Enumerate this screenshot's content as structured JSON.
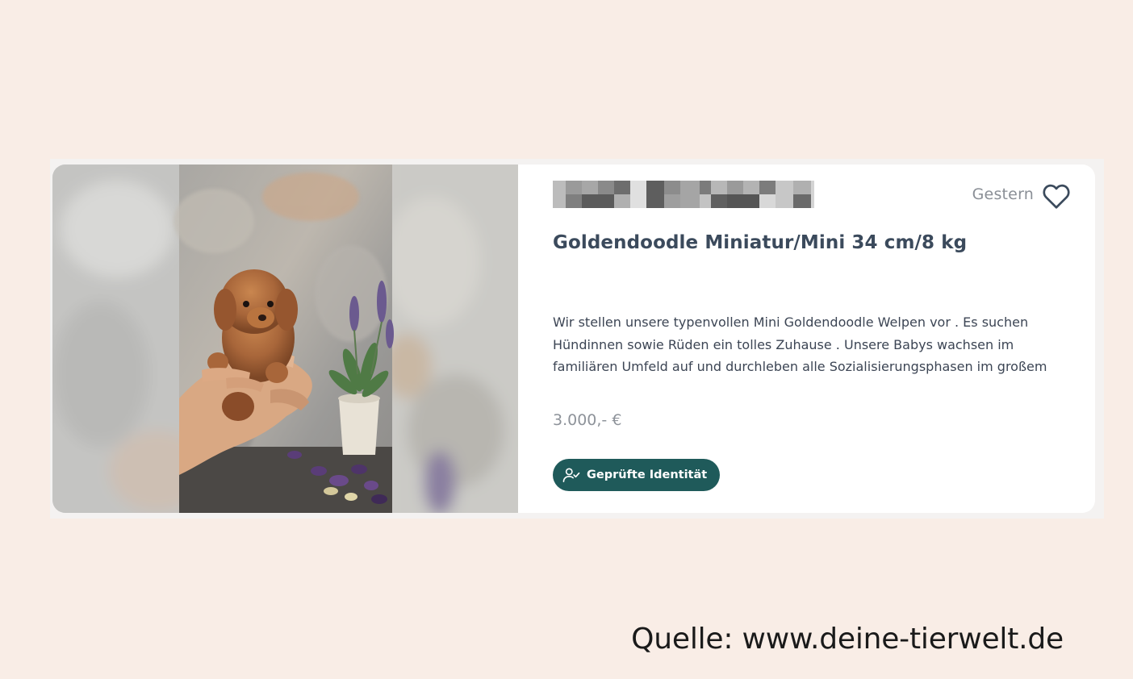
{
  "listing": {
    "date": "Gestern",
    "title": "Goldendoodle Miniatur/Mini 34 cm/8 kg",
    "description": "Wir stellen unsere typenvollen Mini Goldendoodle Welpen vor . Es suchen Hündinnen sowie Rüden ein tolles Zuhause . Unsere Babys wachsen im familiären Umfeld auf und durchleben alle Sozialisierungsphasen im großem",
    "price": "3.000,- €",
    "badge_label": "Geprüfte Identität",
    "icons": {
      "favorite": "heart-icon",
      "badge": "user-check-icon"
    }
  },
  "source_caption": "Quelle: www.deine-tierwelt.de",
  "colors": {
    "page_background": "#f9ede6",
    "card_background": "#ffffff",
    "title": "#3b4a5c",
    "badge_background": "#1f5a5a",
    "muted_text": "#8a8f96"
  }
}
